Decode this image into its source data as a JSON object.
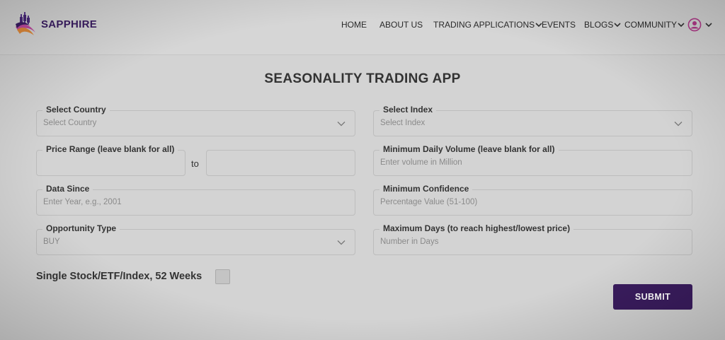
{
  "brand": {
    "name": "SAPPHIRE",
    "logo_icon": "candlestick-swoosh-logo"
  },
  "nav": {
    "items": [
      {
        "label": "HOME",
        "dropdown": false
      },
      {
        "label": "ABOUT US",
        "dropdown": false
      },
      {
        "label": "TRADING APPLICATIONS",
        "dropdown": true
      },
      {
        "label": "EVENTS",
        "dropdown": false
      },
      {
        "label": "BLOGS",
        "dropdown": true
      },
      {
        "label": "COMMUNITY",
        "dropdown": true
      }
    ],
    "user_icon": "user-avatar-icon"
  },
  "page": {
    "title": "SEASONALITY TRADING APP"
  },
  "form": {
    "country": {
      "label": "Select Country",
      "placeholder": "Select Country"
    },
    "index": {
      "label": "Select Index",
      "placeholder": "Select Index"
    },
    "price_range": {
      "label": "Price Range (leave blank for all)",
      "min_value": "",
      "max_value": "",
      "separator": "to"
    },
    "min_volume": {
      "label": "Minimum Daily Volume (leave blank for all)",
      "placeholder": "Enter volume in Million"
    },
    "data_since": {
      "label": "Data Since",
      "placeholder": "Enter Year, e.g., 2001"
    },
    "min_confidence": {
      "label": "Minimum Confidence",
      "placeholder": "Percentage Value (51-100)"
    },
    "opportunity_type": {
      "label": "Opportunity Type",
      "value": "BUY"
    },
    "max_days": {
      "label": "Maximum Days (to reach highest/lowest price)",
      "placeholder": "Number in Days"
    },
    "single_stock": {
      "label": "Single Stock/ETF/Index, 52 Weeks",
      "checked": false
    },
    "submit_label": "SUBMIT"
  },
  "colors": {
    "brand": "#3b1d63",
    "submit": "#3a1c5e",
    "background": "#d3d3d3"
  }
}
